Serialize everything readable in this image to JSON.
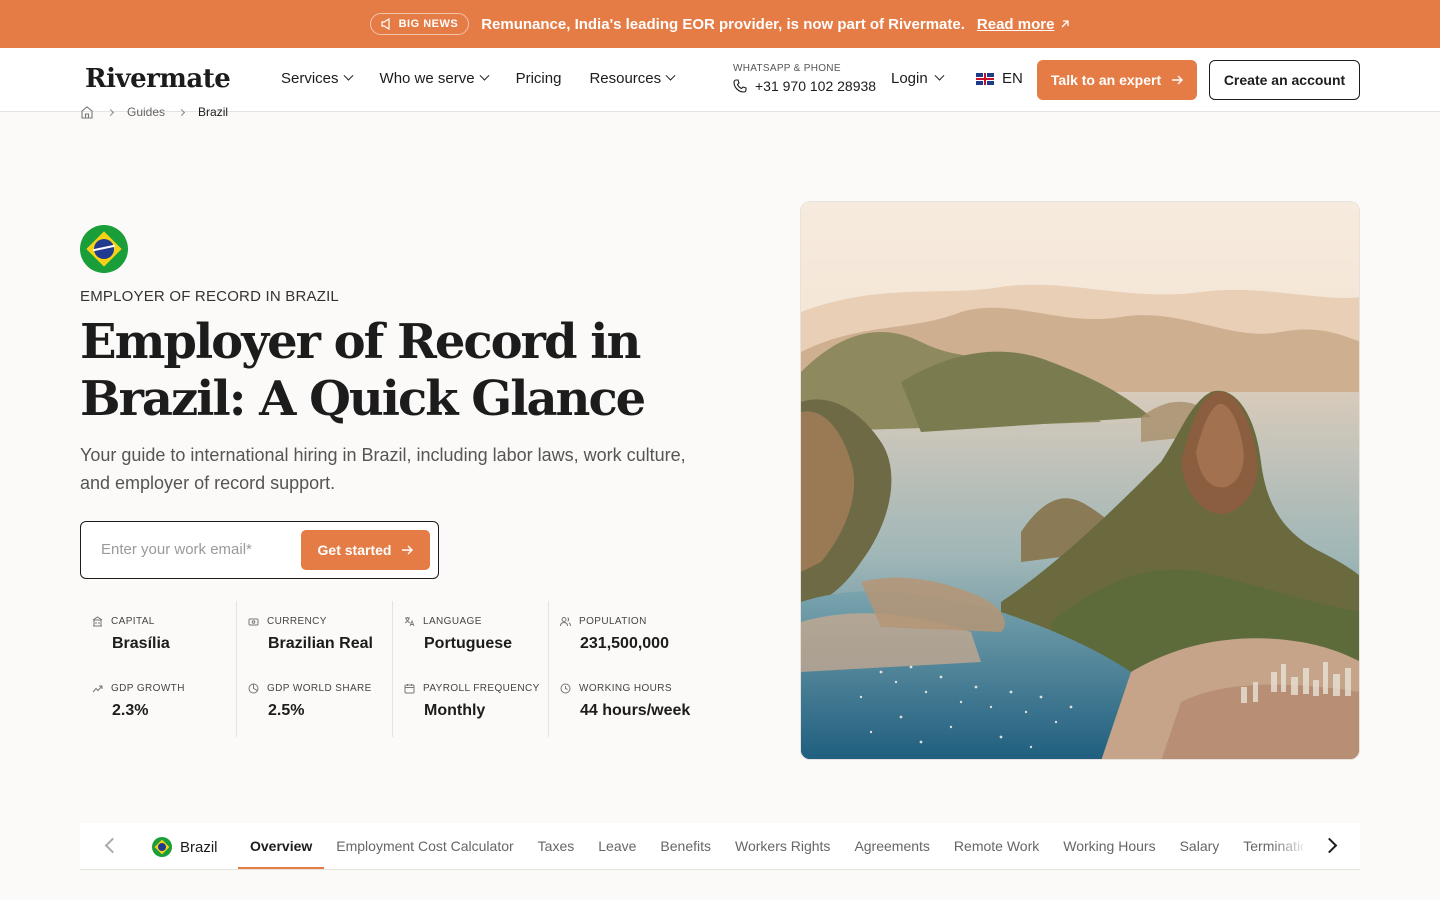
{
  "announcement": {
    "badge": "BIG NEWS",
    "message": "Remunance, India's leading EOR provider, is now part of Rivermate.",
    "link_label": "Read more"
  },
  "header": {
    "logo": "Rivermate",
    "nav": [
      "Services",
      "Who we serve",
      "Pricing",
      "Resources"
    ],
    "contact_label": "WHATSAPP & PHONE",
    "phone": "+31 970 102 28938",
    "login": "Login",
    "language": "EN",
    "cta_primary": "Talk to an expert",
    "cta_secondary": "Create an account"
  },
  "breadcrumb": {
    "items": [
      "Guides",
      "Brazil"
    ]
  },
  "hero": {
    "eyebrow": "EMPLOYER OF RECORD IN BRAZIL",
    "title": "Employer of Record in Brazil: A Quick Glance",
    "lead": "Your guide to international hiring in Brazil, including labor laws, work culture, and employer of record support.",
    "email_placeholder": "Enter your work email*",
    "submit_label": "Get started"
  },
  "stats": [
    {
      "label": "CAPITAL",
      "value": "Brasília",
      "icon": "building-icon"
    },
    {
      "label": "CURRENCY",
      "value": "Brazilian Real",
      "icon": "cash-icon"
    },
    {
      "label": "LANGUAGE",
      "value": "Portuguese",
      "icon": "translate-icon"
    },
    {
      "label": "POPULATION",
      "value": "231,500,000",
      "icon": "people-icon"
    },
    {
      "label": "GDP GROWTH",
      "value": "2.3%",
      "icon": "trend-up-icon"
    },
    {
      "label": "GDP WORLD SHARE",
      "value": "2.5%",
      "icon": "pie-icon"
    },
    {
      "label": "PAYROLL FREQUENCY",
      "value": "Monthly",
      "icon": "calendar-icon"
    },
    {
      "label": "WORKING HOURS",
      "value": "44 hours/week",
      "icon": "clock-icon"
    }
  ],
  "tabs": {
    "country": "Brazil",
    "items": [
      "Overview",
      "Employment Cost Calculator",
      "Taxes",
      "Leave",
      "Benefits",
      "Workers Rights",
      "Agreements",
      "Remote Work",
      "Working Hours",
      "Salary",
      "Termination"
    ],
    "active": "Overview"
  },
  "colors": {
    "accent": "#e57b45",
    "text": "#1c1c1c",
    "background": "#fbfaf8"
  }
}
